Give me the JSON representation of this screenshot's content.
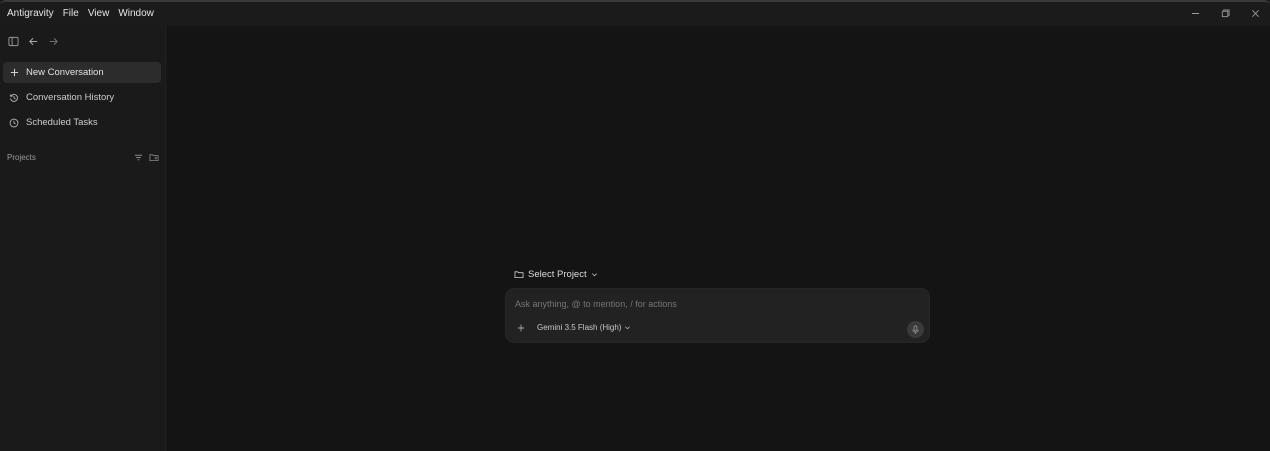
{
  "titlebar": {
    "menu": [
      "Antigravity",
      "File",
      "View",
      "Window"
    ]
  },
  "sidebar": {
    "items": [
      {
        "label": "New Conversation",
        "icon": "plus-icon"
      },
      {
        "label": "Conversation History",
        "icon": "history-icon"
      },
      {
        "label": "Scheduled Tasks",
        "icon": "clock-icon"
      }
    ],
    "projects_label": "Projects"
  },
  "main": {
    "select_project": "Select Project",
    "composer": {
      "placeholder": "Ask anything, @ to mention, / for actions",
      "model": "Gemini 3.5 Flash (High)"
    }
  },
  "colors": {
    "background": "#141414",
    "sidebar": "#1a1a1a",
    "composer": "#222222",
    "active_item": "#2c2c2c"
  }
}
